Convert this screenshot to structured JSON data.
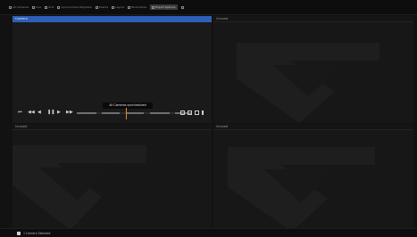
{
  "toolbar": {
    "items": [
      {
        "label": "All Cameras",
        "icon": "camera-icon",
        "selected": false
      },
      {
        "label": "Live",
        "icon": "play-icon",
        "selected": false
      },
      {
        "label": "Grid",
        "icon": "grid-icon",
        "selected": false
      },
      {
        "label": "Synchronized Playback",
        "icon": "sync-icon",
        "selected": false
      },
      {
        "label": "Events",
        "icon": "bell-icon",
        "selected": false
      },
      {
        "label": "Layout",
        "icon": "layout-icon",
        "selected": false
      },
      {
        "label": "Bookmarks",
        "icon": "bookmark-icon",
        "selected": false
      },
      {
        "label": "Export Options",
        "icon": "export-icon",
        "selected": true
      },
      {
        "label": "",
        "icon": "settings-icon",
        "selected": false
      }
    ]
  },
  "panes": [
    {
      "title": "Camera",
      "active": true
    },
    {
      "title": "Unused",
      "active": false
    },
    {
      "title": "Unused",
      "active": false
    },
    {
      "title": "Unused",
      "active": false
    }
  ],
  "playback": {
    "tooltip": "All Cameras synchronized",
    "timeline_labels": [
      "",
      "",
      "",
      "",
      ""
    ],
    "buttons": [
      "skip-back-icon",
      "rewind-icon",
      "step-back-icon",
      "pause-icon",
      "step-forward-icon",
      "fast-forward-icon"
    ],
    "right_icons": [
      "zoom-icon",
      "snapshot-icon",
      "layout-icon",
      "info-icon"
    ]
  },
  "status": {
    "text": "1 Camera Selected"
  },
  "colors": {
    "accent": "#2f5eb8",
    "playhead": "#e08a2a"
  }
}
